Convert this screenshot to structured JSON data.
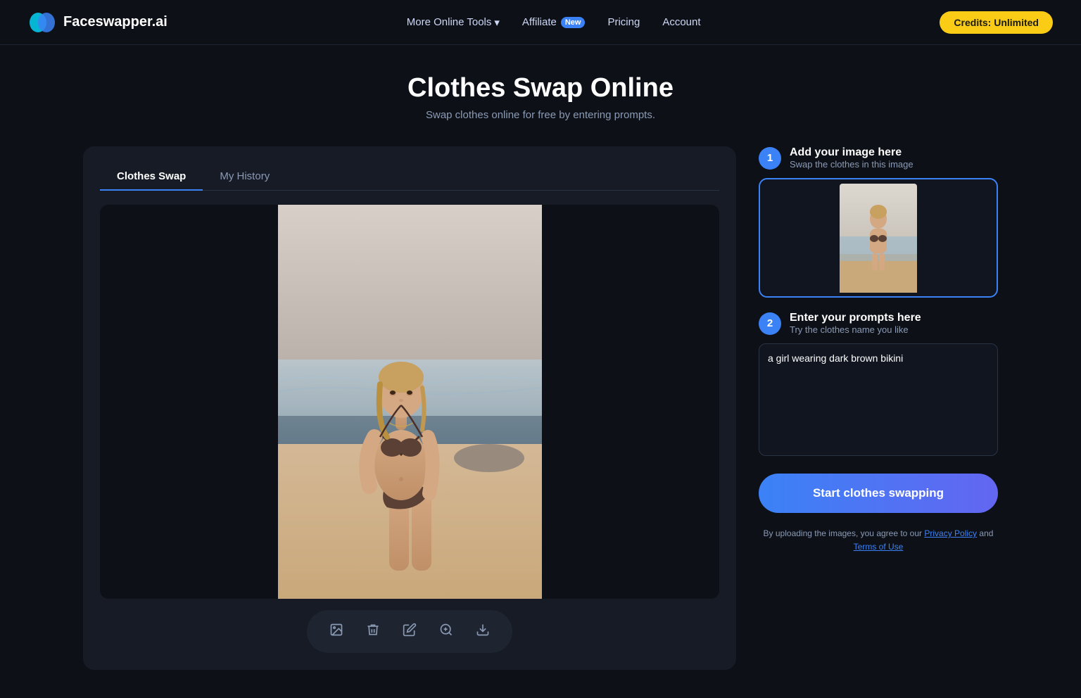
{
  "header": {
    "logo_text": "Faceswapper.ai",
    "nav": {
      "more_tools": "More Online Tools",
      "affiliate": "Affiliate",
      "affiliate_badge": "New",
      "pricing": "Pricing",
      "account": "Account",
      "credits_btn": "Credits: Unlimited"
    }
  },
  "page": {
    "title": "Clothes Swap Online",
    "subtitle": "Swap clothes online for free by entering prompts."
  },
  "tabs": {
    "clothes_swap": "Clothes Swap",
    "my_history": "My History"
  },
  "right_panel": {
    "step1_title": "Add your image here",
    "step1_subtitle": "Swap the clothes in this image",
    "step2_title": "Enter your prompts here",
    "step2_subtitle": "Try the clothes name you like",
    "prompt_value": "a girl wearing dark brown bikini",
    "start_btn": "Start clothes swapping",
    "terms_text": "By uploading the images, you agree to our",
    "privacy_policy": "Privacy Policy",
    "and_text": "and",
    "terms_of_use": "Terms of Use"
  },
  "toolbar": {
    "image_icon": "🖼",
    "trash_icon": "🗑",
    "edit_icon": "✏",
    "zoom_icon": "🔍",
    "download_icon": "⬇"
  },
  "icons": {
    "chevron_down": "▾",
    "logo_primary": "cyan",
    "logo_secondary": "blue"
  }
}
